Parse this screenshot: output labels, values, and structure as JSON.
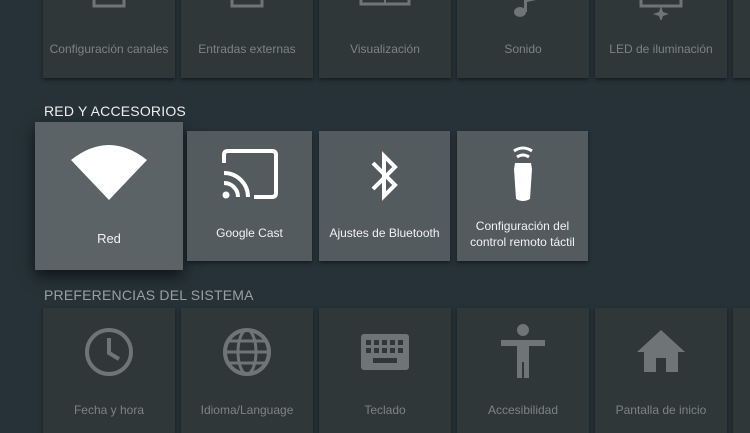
{
  "top_row": {
    "items": [
      {
        "label": "Configuración canales",
        "icon": "tv-channels-icon"
      },
      {
        "label": "Entradas externas",
        "icon": "external-inputs-icon"
      },
      {
        "label": "Visualización",
        "icon": "display-icon"
      },
      {
        "label": "Sonido",
        "icon": "music-note-icon"
      },
      {
        "label": "LED de iluminación",
        "icon": "illumination-led-icon"
      }
    ]
  },
  "network_section": {
    "title": "RED Y ACCESORIOS",
    "items": [
      {
        "label": "Red",
        "icon": "wifi-icon",
        "focused": true
      },
      {
        "label": "Google Cast",
        "icon": "cast-icon"
      },
      {
        "label": "Ajustes de Bluetooth",
        "icon": "bluetooth-icon"
      },
      {
        "label_line1": "Configuración del",
        "label_line2": "control remoto táctil",
        "icon": "touch-remote-icon"
      }
    ]
  },
  "system_section": {
    "title": "PREFERENCIAS DEL SISTEMA",
    "items": [
      {
        "label": "Fecha y hora",
        "icon": "clock-icon"
      },
      {
        "label": "Idioma/Language",
        "icon": "globe-icon"
      },
      {
        "label": "Teclado",
        "icon": "keyboard-icon"
      },
      {
        "label": "Accesibilidad",
        "icon": "accessibility-icon"
      },
      {
        "label": "Pantalla de inicio",
        "icon": "home-icon"
      }
    ]
  },
  "colors": {
    "background": "#263238",
    "tile_dim": "#2f3739",
    "tile_active": "#545b5e"
  }
}
